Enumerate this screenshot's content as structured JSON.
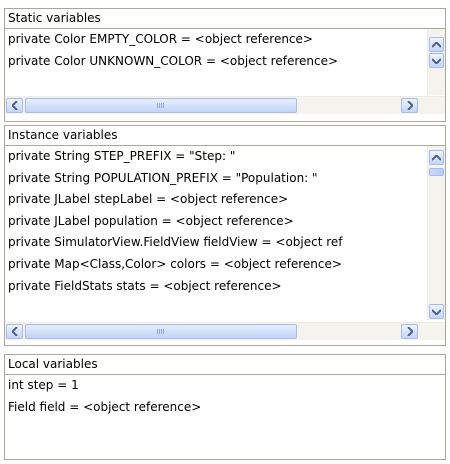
{
  "static": {
    "title": "Static variables",
    "rows": [
      "private Color EMPTY_COLOR = <object reference>",
      "private Color UNKNOWN_COLOR = <object reference>"
    ]
  },
  "instance": {
    "title": "Instance variables",
    "rows": [
      "private String STEP_PREFIX = \"Step: \"",
      "private String POPULATION_PREFIX = \"Population: \"",
      "private JLabel stepLabel = <object reference>",
      "private JLabel population = <object reference>",
      "private SimulatorView.FieldView fieldView = <object ref",
      "private Map<Class,Color> colors = <object reference>",
      "private FieldStats stats = <object reference>"
    ]
  },
  "local": {
    "title": "Local variables",
    "rows": [
      "int step = 1",
      "Field field = <object reference>"
    ]
  },
  "icons": {
    "up": "arrow-up-icon",
    "down": "arrow-down-icon",
    "left": "arrow-left-icon",
    "right": "arrow-right-icon"
  }
}
